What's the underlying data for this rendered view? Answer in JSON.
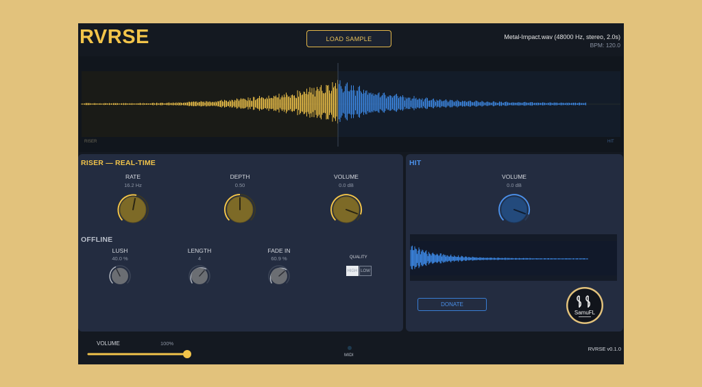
{
  "app": {
    "title": "RVRSE",
    "load_button": "LOAD SAMPLE",
    "file_name": "Metal-Impact.wav (48000 Hz, stereo, 2.0s)",
    "bpm": "BPM: 120.0",
    "version": "RVRSE v0.1.0",
    "brand_colors": {
      "riser": "#f2c44a",
      "hit": "#3a7fd6",
      "background": "#141921",
      "panel": "#232c40",
      "page": "#e2c27c"
    }
  },
  "waveform": {
    "riser_label": "RISER",
    "hit_label": "HIT"
  },
  "riser": {
    "title": "RISER — REAL-TIME",
    "knobs": [
      {
        "label": "RATE",
        "value": "16.2 Hz"
      },
      {
        "label": "DEPTH",
        "value": "0.50"
      },
      {
        "label": "VOLUME",
        "value": "0.0 dB"
      }
    ]
  },
  "offline": {
    "title": "OFFLINE",
    "knobs": [
      {
        "label": "LUSH",
        "value": "40.0 %"
      },
      {
        "label": "LENGTH",
        "value": "4"
      },
      {
        "label": "FADE IN",
        "value": "60.9 %"
      }
    ],
    "quality": {
      "label": "QUALITY",
      "options": [
        "HIGH",
        "LOW"
      ],
      "selected": "HIGH"
    }
  },
  "hit": {
    "title": "HIT",
    "volume_label": "VOLUME",
    "volume_value": "0.0 dB",
    "donate_label": "DONATE",
    "logo_text": "SamuFL"
  },
  "footer": {
    "volume_label": "VOLUME",
    "volume_value": "100%",
    "volume_level": 1.0,
    "midi_label": "MIDI"
  }
}
